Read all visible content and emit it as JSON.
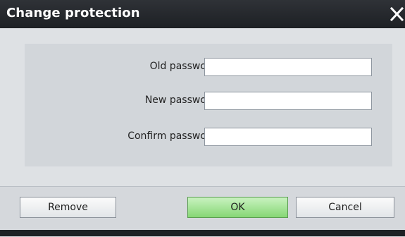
{
  "dialog": {
    "title": "Change protection",
    "close_icon": "close-x-icon"
  },
  "fields": [
    {
      "label": "Old password:",
      "value": "",
      "placeholder": ""
    },
    {
      "label": "New password:",
      "value": "",
      "placeholder": ""
    },
    {
      "label": "Confirm password:",
      "value": "",
      "placeholder": ""
    }
  ],
  "buttons": {
    "remove": "Remove",
    "ok": "OK",
    "cancel": "Cancel"
  },
  "colors": {
    "title_bar": "#1d2024",
    "dialog_body": "#dee1e4",
    "ok_button": "#86d775"
  }
}
